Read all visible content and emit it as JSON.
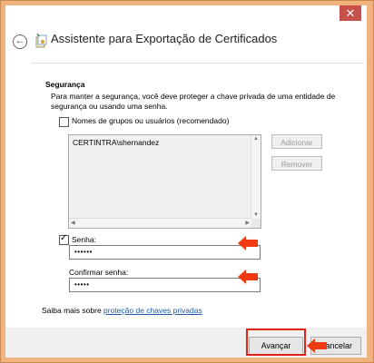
{
  "window": {
    "title": "Assistente para Exportação de Certificados",
    "close_glyph": "✕"
  },
  "security": {
    "heading": "Segurança",
    "description": "Para manter a segurança, você deve proteger a chave privada de uma entidade de segurança ou usando uma senha."
  },
  "groups": {
    "checkbox_label": "Nomes de grupos ou usuários (recomendado)",
    "checked": false,
    "list_items": [
      "CERTINTRA\\shernandez"
    ],
    "add_label": "Adicionar",
    "remove_label": "Remover"
  },
  "password": {
    "checkbox_label": "Senha:",
    "checked": true,
    "value": "••••••",
    "confirm_label": "Confirmar senha:",
    "confirm_value": "•••••"
  },
  "more_info": {
    "prefix": "Saiba mais sobre ",
    "link": "proteção de chaves privadas"
  },
  "footer": {
    "next_label": "Avançar",
    "cancel_label": "Cancelar"
  },
  "annotations": {
    "highlight_color": "#e0231a",
    "arrow_color": "#f03a12"
  }
}
